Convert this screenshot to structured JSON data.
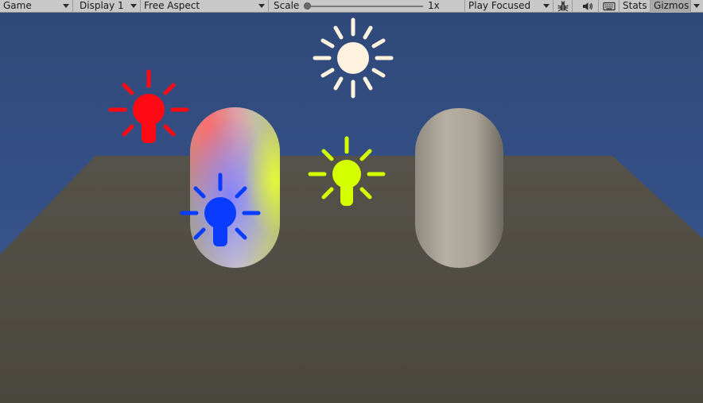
{
  "toolbar": {
    "view_dropdown": "Game",
    "display_dropdown": "Display 1",
    "aspect_dropdown": "Free Aspect",
    "scale_label": "Scale",
    "scale_value": "1x",
    "scale_fraction": 0.0,
    "play_mode_dropdown": "Play Focused",
    "bug_icon": "bug-icon",
    "audio_icon": "speaker-icon",
    "keyboard_icon": "keyboard-icon",
    "stats_label": "Stats",
    "gizmos_label": "Gizmos"
  },
  "scene": {
    "sky_color": "#334d7a",
    "ground_color": "#4f4c44",
    "directional_light_color": "#fff3e0",
    "point_lights": [
      {
        "name": "red-light",
        "color": "#ff0a14"
      },
      {
        "name": "blue-light",
        "color": "#0a3cff"
      },
      {
        "name": "yellow-light",
        "color": "#d4ff00"
      }
    ],
    "capsule_color": "#b4ad9f"
  }
}
